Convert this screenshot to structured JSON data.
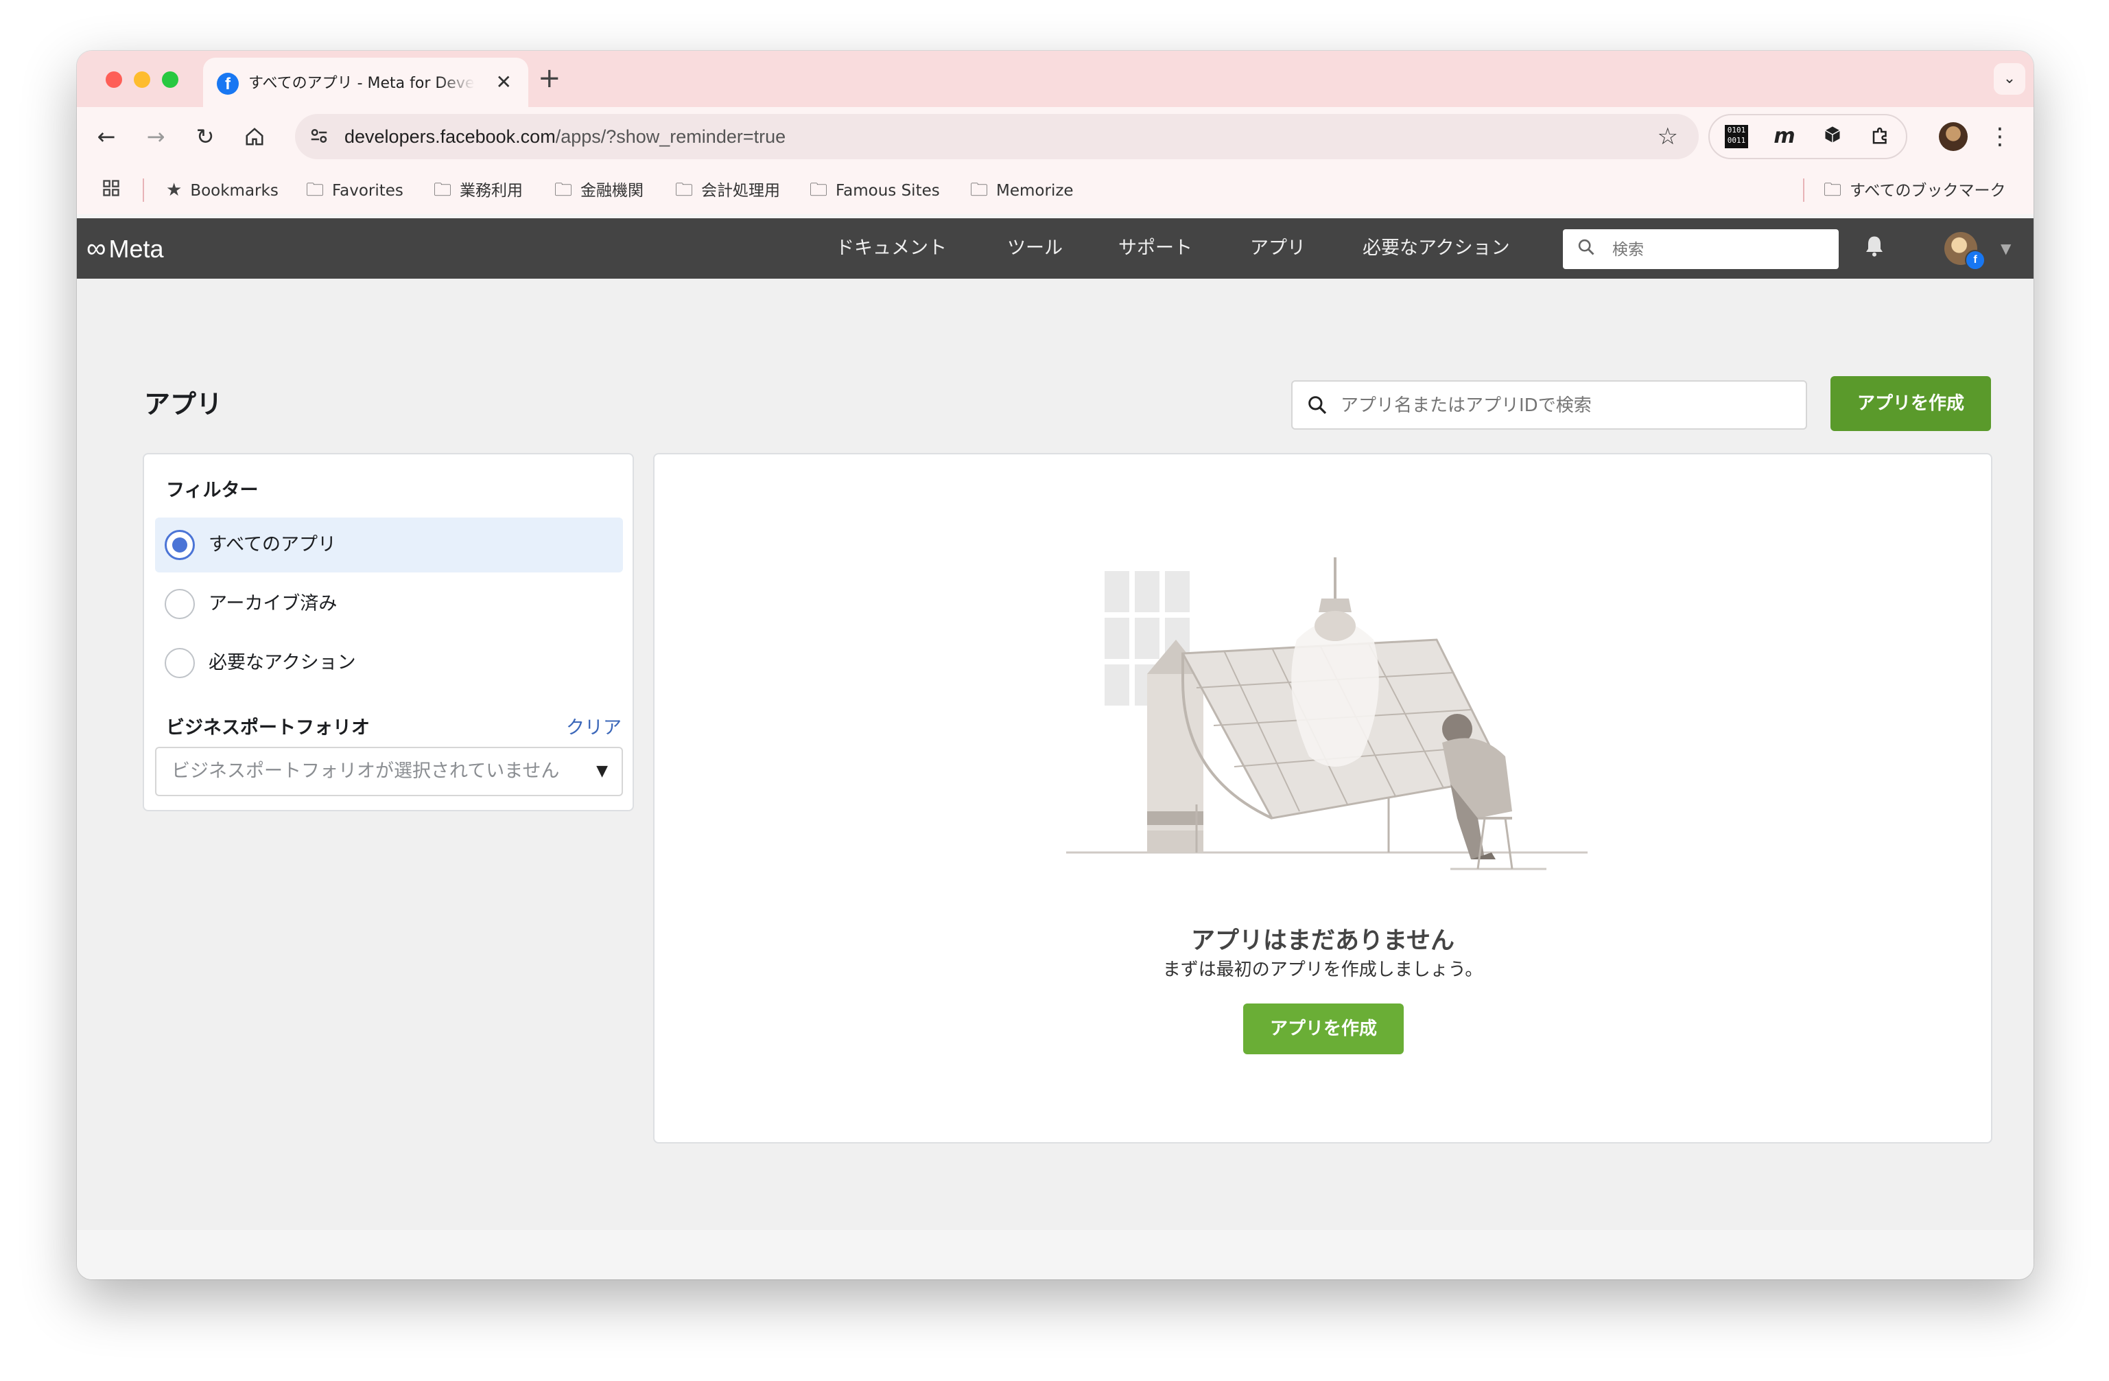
{
  "browser": {
    "tab_title": "すべてのアプリ - Meta for Developers",
    "tab_favicon": "f",
    "tab_close": "✕",
    "new_tab": "+",
    "tab_menu": "⌄",
    "url_host": "developers.facebook.com",
    "url_path": "/apps/?show_reminder=true",
    "ext_binary": "0101 0011",
    "ext_m": "m"
  },
  "bookmarks": {
    "items": [
      "Bookmarks",
      "Favorites",
      "業務利用",
      "金融機関",
      "会計処理用",
      "Famous Sites",
      "Memorize"
    ],
    "all_bookmarks": "すべてのブックマーク"
  },
  "meta_header": {
    "logo": "Meta",
    "nav": [
      "ドキュメント",
      "ツール",
      "サポート",
      "アプリ",
      "必要なアクション"
    ],
    "search_placeholder": "検索",
    "badge": "f"
  },
  "page": {
    "title": "アプリ",
    "search_placeholder": "アプリ名またはアプリIDで検索",
    "create_button": "アプリを作成"
  },
  "filters": {
    "title": "フィルター",
    "options": [
      "すべてのアプリ",
      "アーカイブ済み",
      "必要なアクション"
    ],
    "selected": "すべてのアプリ",
    "business_label": "ビジネスポートフォリオ",
    "clear": "クリア",
    "business_select_value": "ビジネスポートフォリオが選択されていません"
  },
  "empty_state": {
    "title": "アプリはまだありません",
    "subtitle": "まずは最初のアプリを作成しましょう。",
    "button": "アプリを作成"
  },
  "colors": {
    "accent_green": "#5a9a2b",
    "radio_blue": "#4b74d6",
    "link_blue": "#3b67b9",
    "header_bg": "#444444",
    "tabstrip_bg": "#f9dcdd"
  }
}
